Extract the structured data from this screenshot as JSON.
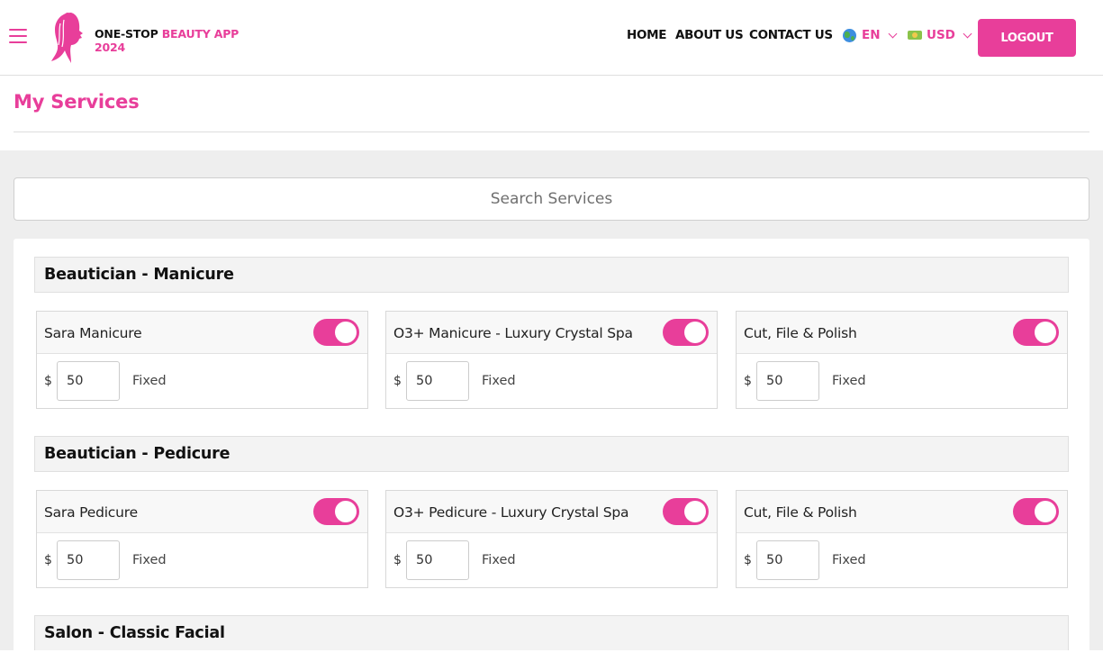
{
  "header": {
    "logo": {
      "line1_a": "ONE-STOP",
      "line1_b": "BEAUTY APP",
      "line2": "2024"
    },
    "nav": {
      "home": "HOME",
      "about": "ABOUT US",
      "contact": "CONTACT US"
    },
    "language": {
      "value": "EN",
      "icon": "globe-icon"
    },
    "currency": {
      "value": "USD",
      "icon": "money-icon"
    },
    "logout_label": "LOGOUT"
  },
  "page": {
    "title": "My Services"
  },
  "search": {
    "placeholder": "Search Services"
  },
  "colors": {
    "accent": "#e83e9a",
    "body_bg": "#eeeeee"
  },
  "categories": [
    {
      "title": "Beautician - Manicure",
      "services": [
        {
          "name": "Sara Manicure",
          "enabled": true,
          "currency": "$",
          "price": "50",
          "price_type": "Fixed"
        },
        {
          "name": "O3+ Manicure - Luxury Crystal Spa",
          "enabled": true,
          "currency": "$",
          "price": "50",
          "price_type": "Fixed"
        },
        {
          "name": "Cut, File & Polish",
          "enabled": true,
          "currency": "$",
          "price": "50",
          "price_type": "Fixed"
        }
      ]
    },
    {
      "title": "Beautician - Pedicure",
      "services": [
        {
          "name": "Sara Pedicure",
          "enabled": true,
          "currency": "$",
          "price": "50",
          "price_type": "Fixed"
        },
        {
          "name": "O3+ Pedicure - Luxury Crystal Spa",
          "enabled": true,
          "currency": "$",
          "price": "50",
          "price_type": "Fixed"
        },
        {
          "name": "Cut, File & Polish",
          "enabled": true,
          "currency": "$",
          "price": "50",
          "price_type": "Fixed"
        }
      ]
    },
    {
      "title": "Salon - Classic Facial",
      "services": []
    }
  ]
}
